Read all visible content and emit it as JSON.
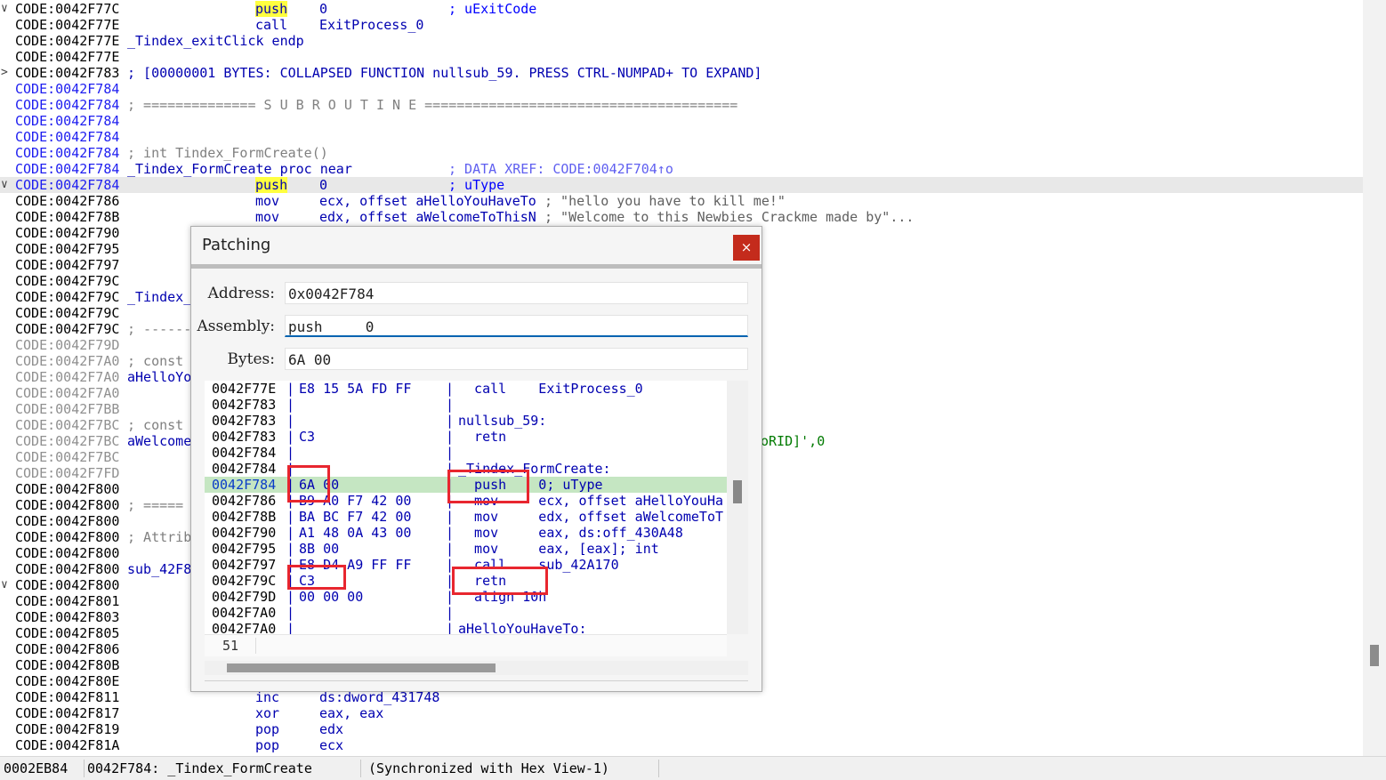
{
  "listing": [
    {
      "chev": "∨",
      "addr": "CODE:0042F77C",
      "addr_style": "black",
      "mnem": "push",
      "mnem_hl": true,
      "ops": "0",
      "cmt": "; uExitCode",
      "cmt_style": "blue"
    },
    {
      "chev": "",
      "addr": "CODE:0042F77E",
      "addr_style": "black",
      "mnem": "call",
      "ops": "ExitProcess_0"
    },
    {
      "chev": "",
      "addr": "CODE:0042F77E",
      "addr_style": "black",
      "label": "_Tindex_exitClick endp"
    },
    {
      "chev": "",
      "addr": "CODE:0042F77E",
      "addr_style": "black"
    },
    {
      "chev": ">",
      "addr": "CODE:0042F783",
      "addr_style": "black",
      "label": "; [00000001 BYTES: COLLAPSED FUNCTION nullsub_59. PRESS CTRL-NUMPAD+ TO EXPAND]"
    },
    {
      "chev": "",
      "addr": "CODE:0042F784",
      "addr_style": "blue"
    },
    {
      "chev": "",
      "addr": "CODE:0042F784",
      "addr_style": "blue",
      "label": "; ============== S U B R O U T I N E =======================================",
      "label_style": "gray"
    },
    {
      "chev": "",
      "addr": "CODE:0042F784",
      "addr_style": "blue"
    },
    {
      "chev": "",
      "addr": "CODE:0042F784",
      "addr_style": "blue"
    },
    {
      "chev": "",
      "addr": "CODE:0042F784",
      "addr_style": "blue",
      "label": "; int Tindex_FormCreate()",
      "label_style": "gray"
    },
    {
      "chev": "",
      "addr": "CODE:0042F784",
      "addr_style": "blue",
      "label": "_Tindex_FormCreate proc near",
      "cmt": "; DATA XREF: CODE:0042F704↑o",
      "cmt_style": "xref"
    },
    {
      "chev": "∨",
      "addr": "CODE:0042F784",
      "addr_style": "blue",
      "mnem": "push",
      "mnem_hl": true,
      "ops": "0",
      "cmt": "; uType",
      "cmt_style": "blue",
      "hl": true
    },
    {
      "chev": "",
      "addr": "CODE:0042F786",
      "addr_style": "black",
      "mnem": "mov",
      "ops": "ecx, offset aHelloYouHaveTo",
      "cmt": "; \"hello you have to kill me!\"",
      "cmt_style": "gray",
      "cmt_offset": true
    },
    {
      "chev": "",
      "addr": "CODE:0042F78B",
      "addr_style": "black",
      "mnem": "mov",
      "ops": "edx, offset aWelcomeToThisN",
      "cmt": "; \"Welcome to this Newbies Crackme made by\"...",
      "cmt_style": "gray",
      "cmt_offset": true
    },
    {
      "chev": "",
      "addr": "CODE:0042F790",
      "addr_style": "black"
    },
    {
      "chev": "",
      "addr": "CODE:0042F795",
      "addr_style": "black"
    },
    {
      "chev": "",
      "addr": "CODE:0042F797",
      "addr_style": "black"
    },
    {
      "chev": "",
      "addr": "CODE:0042F79C",
      "addr_style": "black"
    },
    {
      "chev": "",
      "addr": "CODE:0042F79C",
      "addr_style": "black",
      "label": "_Tindex_"
    },
    {
      "chev": "",
      "addr": "CODE:0042F79C",
      "addr_style": "black"
    },
    {
      "chev": "",
      "addr": "CODE:0042F79C",
      "addr_style": "black",
      "label": "; ------",
      "label_style": "gray"
    },
    {
      "chev": "",
      "addr": "CODE:0042F79D",
      "addr_style": "gray"
    },
    {
      "chev": "",
      "addr": "CODE:0042F7A0",
      "addr_style": "gray",
      "label": "; const",
      "label_style": "gray"
    },
    {
      "chev": "",
      "addr": "CODE:0042F7A0",
      "addr_style": "gray",
      "label": "aHelloYo"
    },
    {
      "chev": "",
      "addr": "CODE:0042F7A0",
      "addr_style": "gray"
    },
    {
      "chev": "",
      "addr": "CODE:0042F7BB",
      "addr_style": "gray"
    },
    {
      "chev": "",
      "addr": "CODE:0042F7BC",
      "addr_style": "gray",
      "label": "; const",
      "label_style": "gray"
    },
    {
      "chev": "",
      "addr": "CODE:0042F7BC",
      "addr_style": "gray",
      "label": "aWelcome",
      "tail": "oRID]',0"
    },
    {
      "chev": "",
      "addr": "CODE:0042F7BC",
      "addr_style": "gray"
    },
    {
      "chev": "",
      "addr": "CODE:0042F7FD",
      "addr_style": "gray"
    },
    {
      "chev": "",
      "addr": "CODE:0042F800",
      "addr_style": "black"
    },
    {
      "chev": "",
      "addr": "CODE:0042F800",
      "addr_style": "black",
      "label": "; =====",
      "label_style": "gray"
    },
    {
      "chev": "",
      "addr": "CODE:0042F800",
      "addr_style": "black"
    },
    {
      "chev": "",
      "addr": "CODE:0042F800",
      "addr_style": "black",
      "label": "; Attrib",
      "label_style": "gray"
    },
    {
      "chev": "",
      "addr": "CODE:0042F800",
      "addr_style": "black"
    },
    {
      "chev": "",
      "addr": "CODE:0042F800",
      "addr_style": "black",
      "label": "sub_42F8"
    },
    {
      "chev": "∨",
      "addr": "CODE:0042F800",
      "addr_style": "black"
    },
    {
      "chev": "",
      "addr": "CODE:0042F801",
      "addr_style": "black"
    },
    {
      "chev": "",
      "addr": "CODE:0042F803",
      "addr_style": "black"
    },
    {
      "chev": "",
      "addr": "CODE:0042F805",
      "addr_style": "black"
    },
    {
      "chev": "",
      "addr": "CODE:0042F806",
      "addr_style": "black"
    },
    {
      "chev": "",
      "addr": "CODE:0042F80B",
      "addr_style": "black"
    },
    {
      "chev": "",
      "addr": "CODE:0042F80E",
      "addr_style": "black"
    },
    {
      "chev": "",
      "addr": "CODE:0042F811",
      "addr_style": "black",
      "mnem": "inc",
      "ops": "ds:dword_431748"
    },
    {
      "chev": "",
      "addr": "CODE:0042F817",
      "addr_style": "black",
      "mnem": "xor",
      "ops": "eax, eax"
    },
    {
      "chev": "",
      "addr": "CODE:0042F819",
      "addr_style": "black",
      "mnem": "pop",
      "ops": "edx"
    },
    {
      "chev": "",
      "addr": "CODE:0042F81A",
      "addr_style": "black",
      "mnem": "pop",
      "ops": "ecx"
    }
  ],
  "status": {
    "offset": "0002EB84",
    "location": "0042F784: _Tindex_FormCreate",
    "sync": "(Synchronized with Hex View-1)"
  },
  "dialog": {
    "title": "Patching",
    "close_glyph": "×",
    "address_label": "Address:",
    "address_value": "0x0042F784",
    "assembly_label": "Assembly:",
    "assembly_value": "push     0",
    "bytes_label": "Bytes:",
    "bytes_value": "6A 00",
    "line_number": "51",
    "preview": [
      {
        "addr": "0042F77E",
        "bytes": "E8 15 5A FD FF",
        "asm": "  call    ExitProcess_0"
      },
      {
        "addr": "0042F783",
        "bytes": "",
        "asm": ""
      },
      {
        "addr": "0042F783",
        "bytes": "",
        "asm": "nullsub_59:"
      },
      {
        "addr": "0042F783",
        "bytes": "C3",
        "asm": "  retn"
      },
      {
        "addr": "0042F784",
        "bytes": "",
        "asm": ""
      },
      {
        "addr": "0042F784",
        "bytes": "",
        "asm": "_Tindex_FormCreate:"
      },
      {
        "addr": "0042F784",
        "bytes": "6A 00",
        "asm": "  push    0; uType",
        "selected": true
      },
      {
        "addr": "0042F786",
        "bytes": "B9 A0 F7 42 00",
        "asm": "  mov     ecx, offset aHelloYouHa"
      },
      {
        "addr": "0042F78B",
        "bytes": "BA BC F7 42 00",
        "asm": "  mov     edx, offset aWelcomeToT"
      },
      {
        "addr": "0042F790",
        "bytes": "A1 48 0A 43 00",
        "asm": "  mov     eax, ds:off_430A48"
      },
      {
        "addr": "0042F795",
        "bytes": "8B 00",
        "asm": "  mov     eax, [eax]; int"
      },
      {
        "addr": "0042F797",
        "bytes": "E8 D4 A9 FF FF",
        "asm": "  call    sub_42A170"
      },
      {
        "addr": "0042F79C",
        "bytes": "C3",
        "asm": "  retn"
      },
      {
        "addr": "0042F79D",
        "bytes": "00 00 00",
        "asm": "  align 10h"
      },
      {
        "addr": "0042F7A0",
        "bytes": "",
        "asm": ""
      },
      {
        "addr": "0042F7A0",
        "bytes": "",
        "asm": "aHelloYouHaveTo:"
      }
    ]
  },
  "colors": {
    "highlight_yellow": "#ffff40",
    "selection_green": "#c5e6c2",
    "annotation_red": "#e8262f",
    "close_red": "#c42b1c",
    "code_blue": "#0000b0"
  }
}
